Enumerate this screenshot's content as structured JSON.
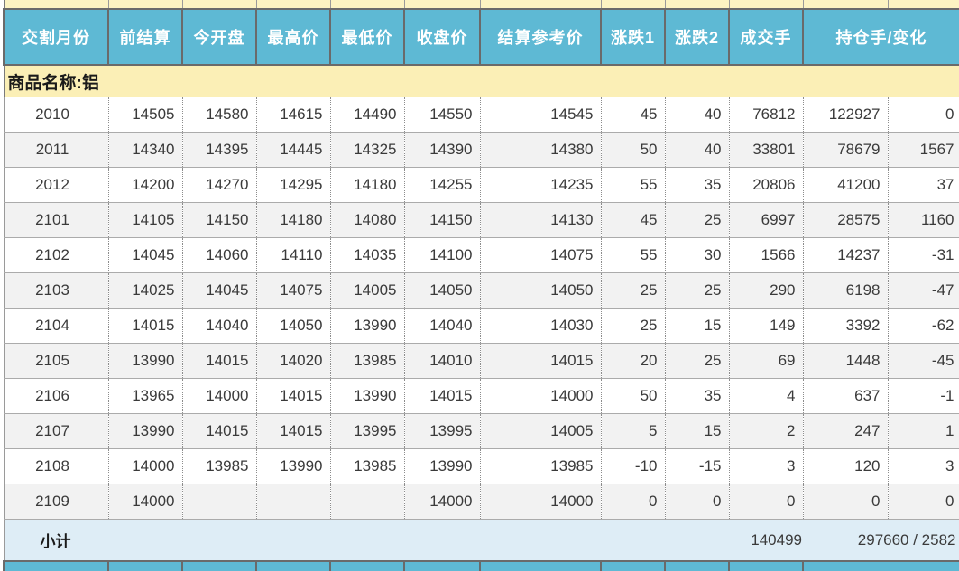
{
  "table": {
    "group_label": "商品名称:铝",
    "columns": [
      {
        "label": "交割月份"
      },
      {
        "label": "前结算"
      },
      {
        "label": "今开盘"
      },
      {
        "label": "最高价"
      },
      {
        "label": "最低价"
      },
      {
        "label": "收盘价"
      },
      {
        "label": "结算参考价"
      },
      {
        "label": "涨跌1"
      },
      {
        "label": "涨跌2"
      },
      {
        "label": "成交手"
      },
      {
        "label": "持仓手/变化"
      }
    ],
    "rows": [
      {
        "month": "2010",
        "prev_settle": "14505",
        "open": "14580",
        "high": "14615",
        "low": "14490",
        "close": "14550",
        "settle_ref": "14545",
        "chg1": "45",
        "chg2": "40",
        "volume": "76812",
        "open_interest": "122927",
        "oi_change": "0"
      },
      {
        "month": "2011",
        "prev_settle": "14340",
        "open": "14395",
        "high": "14445",
        "low": "14325",
        "close": "14390",
        "settle_ref": "14380",
        "chg1": "50",
        "chg2": "40",
        "volume": "33801",
        "open_interest": "78679",
        "oi_change": "1567"
      },
      {
        "month": "2012",
        "prev_settle": "14200",
        "open": "14270",
        "high": "14295",
        "low": "14180",
        "close": "14255",
        "settle_ref": "14235",
        "chg1": "55",
        "chg2": "35",
        "volume": "20806",
        "open_interest": "41200",
        "oi_change": "37"
      },
      {
        "month": "2101",
        "prev_settle": "14105",
        "open": "14150",
        "high": "14180",
        "low": "14080",
        "close": "14150",
        "settle_ref": "14130",
        "chg1": "45",
        "chg2": "25",
        "volume": "6997",
        "open_interest": "28575",
        "oi_change": "1160"
      },
      {
        "month": "2102",
        "prev_settle": "14045",
        "open": "14060",
        "high": "14110",
        "low": "14035",
        "close": "14100",
        "settle_ref": "14075",
        "chg1": "55",
        "chg2": "30",
        "volume": "1566",
        "open_interest": "14237",
        "oi_change": "-31"
      },
      {
        "month": "2103",
        "prev_settle": "14025",
        "open": "14045",
        "high": "14075",
        "low": "14005",
        "close": "14050",
        "settle_ref": "14050",
        "chg1": "25",
        "chg2": "25",
        "volume": "290",
        "open_interest": "6198",
        "oi_change": "-47"
      },
      {
        "month": "2104",
        "prev_settle": "14015",
        "open": "14040",
        "high": "14050",
        "low": "13990",
        "close": "14040",
        "settle_ref": "14030",
        "chg1": "25",
        "chg2": "15",
        "volume": "149",
        "open_interest": "3392",
        "oi_change": "-62"
      },
      {
        "month": "2105",
        "prev_settle": "13990",
        "open": "14015",
        "high": "14020",
        "low": "13985",
        "close": "14010",
        "settle_ref": "14015",
        "chg1": "20",
        "chg2": "25",
        "volume": "69",
        "open_interest": "1448",
        "oi_change": "-45"
      },
      {
        "month": "2106",
        "prev_settle": "13965",
        "open": "14000",
        "high": "14015",
        "low": "13990",
        "close": "14015",
        "settle_ref": "14000",
        "chg1": "50",
        "chg2": "35",
        "volume": "4",
        "open_interest": "637",
        "oi_change": "-1"
      },
      {
        "month": "2107",
        "prev_settle": "13990",
        "open": "14015",
        "high": "14015",
        "low": "13995",
        "close": "13995",
        "settle_ref": "14005",
        "chg1": "5",
        "chg2": "15",
        "volume": "2",
        "open_interest": "247",
        "oi_change": "1"
      },
      {
        "month": "2108",
        "prev_settle": "14000",
        "open": "13985",
        "high": "13990",
        "low": "13985",
        "close": "13990",
        "settle_ref": "13985",
        "chg1": "-10",
        "chg2": "-15",
        "volume": "3",
        "open_interest": "120",
        "oi_change": "3"
      },
      {
        "month": "2109",
        "prev_settle": "14000",
        "open": "",
        "high": "",
        "low": "",
        "close": "14000",
        "settle_ref": "14000",
        "chg1": "0",
        "chg2": "0",
        "volume": "0",
        "open_interest": "0",
        "oi_change": "0"
      }
    ],
    "subtotal": {
      "label": "小计",
      "volume_total": "140499",
      "open_interest_total": "297660 / 2582"
    }
  },
  "colors": {
    "header_background": "#5EB9D4",
    "group_band_background": "#FBEFB6",
    "top_strip_background": "#FCF3C2",
    "zebra_row_background": "#F2F2F2",
    "subtotal_background": "#DEEDF6",
    "header_text": "#FFFFFF",
    "body_text": "#3A3A3A"
  }
}
